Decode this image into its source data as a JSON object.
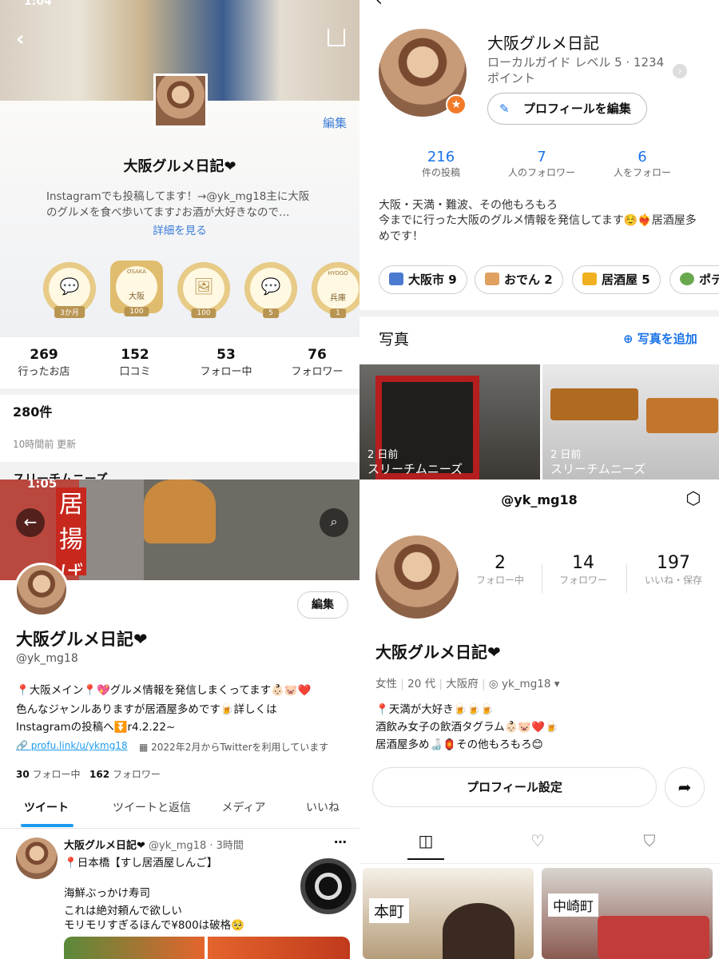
{
  "q1": {
    "status_time": "1:04",
    "edit_label": "編集",
    "name": "大阪グルメ日記❤",
    "bio": "Instagramでも投稿してます！→@yk_mg18主に大阪のグルメを食べ歩いてます♪お酒が大好きなので…",
    "more_label": "詳細を見る",
    "badges": [
      {
        "icon": "speech-bubble-icon",
        "label": "3か月"
      },
      {
        "icon": "osaka-hexagon-icon",
        "top": "OSAKA",
        "mid": "大阪",
        "label": "100"
      },
      {
        "icon": "photo-bubble-icon",
        "label": "100"
      },
      {
        "icon": "store-bubble-icon",
        "label": "5"
      },
      {
        "icon": "hyogo-map-icon",
        "top": "HYOGO",
        "mid": "兵庫",
        "label": "1"
      }
    ],
    "stats": [
      {
        "n": "269",
        "l": "行ったお店"
      },
      {
        "n": "152",
        "l": "口コミ"
      },
      {
        "n": "53",
        "l": "フォロー中"
      },
      {
        "n": "76",
        "l": "フォロワー"
      }
    ],
    "count": "280件",
    "updated": "10時間前 更新",
    "partial_row": "スリーチムニーズ"
  },
  "q2": {
    "name": "大阪グルメ日記",
    "level": "ローカルガイド レベル 5 · 1234 ポイント",
    "edit_profile": "プロフィールを編集",
    "stats": [
      {
        "n": "216",
        "l": "件の投稿"
      },
      {
        "n": "7",
        "l": "人のフォロワー"
      },
      {
        "n": "6",
        "l": "人をフォロー"
      }
    ],
    "bio_line1": "大阪・天満・難波、その他もろもろ",
    "bio_line2": "今までに行った大阪のグルメ情報を発信してます☺️❤️‍🔥居酒屋多めです！",
    "chips": [
      "大阪市 9",
      "おでん 2",
      "居酒屋 5",
      "ポテ"
    ],
    "photos_title": "写真",
    "add_photo": "写真を追加",
    "photos": [
      {
        "date": "2 日前",
        "place": "スリーチムニーズ"
      },
      {
        "date": "2 日前",
        "place": "スリーチムニーズ"
      }
    ]
  },
  "q3": {
    "status_time": "1:05",
    "edit_label": "編集",
    "name": "大阪グルメ日記❤",
    "handle": "@yk_mg18",
    "bio1": "📍大阪メイン📍💖グルメ情報を発信しまくってます👶🏻🐷❤️",
    "bio2": "色んなジャンルありますが居酒屋多めです🍺詳しくは",
    "bio3": "Instagramの投稿へ⏬r4.2.22~",
    "link": "profu.link/u/ykmg18",
    "joined": "2022年2月からTwitterを利用しています",
    "following_n": "30",
    "following_l": "フォロー中",
    "followers_n": "162",
    "followers_l": "フォロワー",
    "tabs": [
      "ツイート",
      "ツイートと返信",
      "メディア",
      "いいね"
    ],
    "tweet_name": "大阪グルメ日記❤",
    "tweet_meta": "@yk_mg18 · 3時間",
    "tweet_l1": "📍日本橋【すし居酒屋しんご】",
    "tweet_l2": "海鮮ぶっかけ寿司",
    "tweet_l3": "これは絶対頼んで欲しい",
    "tweet_l4": "モリモリすぎるほんで¥800は破格🥺",
    "sign_text": "居揚げ"
  },
  "q4": {
    "handle": "@yk_mg18",
    "stats": [
      {
        "n": "2",
        "l": "フォロー中"
      },
      {
        "n": "14",
        "l": "フォロワー"
      },
      {
        "n": "197",
        "l": "いいね・保存"
      }
    ],
    "name": "大阪グルメ日記❤",
    "gender": "女性",
    "age": "20 代",
    "pref": "大阪府",
    "insta": "yk_mg18",
    "bio1": "📍天満が大好き🍺🍺🍺",
    "bio2": "酒飲み女子の飲酒タグラム👶🏻🐷❤️🍺",
    "bio3": "居酒屋多め🍶🏮その他もろもろ😊",
    "settings": "プロフィール設定",
    "grid": [
      {
        "label": "本町"
      },
      {
        "label": "中崎町"
      }
    ]
  }
}
